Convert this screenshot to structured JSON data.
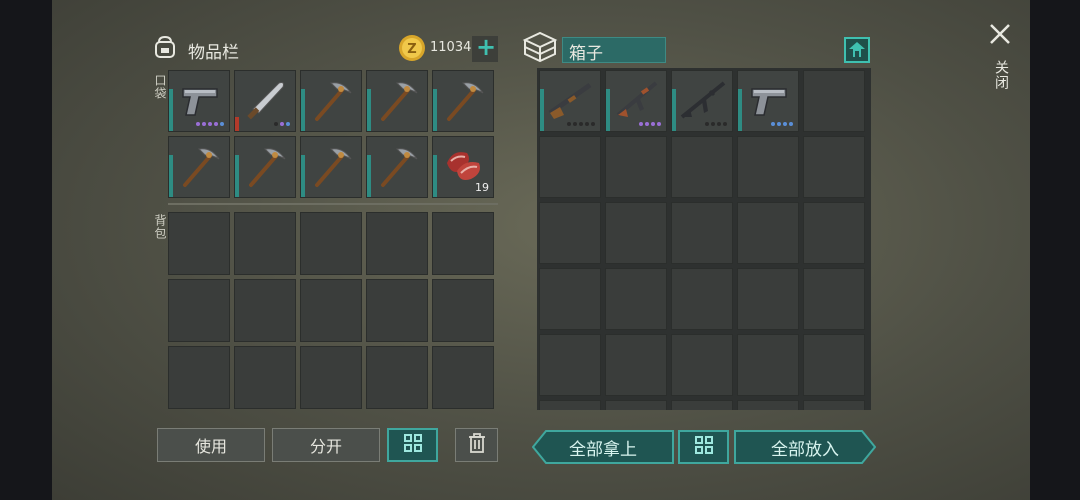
{
  "inventory": {
    "title": "物品栏",
    "pocket_label": "口袋",
    "backpack_label": "背包",
    "pocket_items": [
      {
        "icon": "pistol-icon",
        "dots": [
          "p",
          "p",
          "p",
          "p",
          "b"
        ]
      },
      {
        "icon": "machete-icon",
        "dots": [
          "",
          "p",
          "b"
        ],
        "bar": "red"
      },
      {
        "icon": "pickaxe-icon"
      },
      {
        "icon": "pickaxe-icon"
      },
      {
        "icon": "pickaxe-icon"
      },
      {
        "icon": "pickaxe-icon"
      },
      {
        "icon": "pickaxe-icon"
      },
      {
        "icon": "pickaxe-icon"
      },
      {
        "icon": "pickaxe-icon"
      },
      {
        "icon": "raw-meat-icon",
        "qty": "19"
      }
    ]
  },
  "currency": {
    "icon": "coin-icon",
    "amount": "11034",
    "add_icon": "plus-icon"
  },
  "box": {
    "title": "箱子",
    "items": [
      {
        "icon": "shotgun-icon",
        "dots": [
          "",
          "",
          "",
          "",
          ""
        ]
      },
      {
        "icon": "assault-rifle-icon",
        "dots": [
          "p",
          "p",
          "p",
          "p"
        ]
      },
      {
        "icon": "rifle-icon",
        "dots": [
          "",
          "",
          "",
          ""
        ]
      },
      {
        "icon": "pistol-icon",
        "dots": [
          "b",
          "b",
          "b",
          "b"
        ]
      }
    ]
  },
  "buttons": {
    "use": "使用",
    "split": "分开",
    "take_all": "全部拿上",
    "put_all": "全部放入"
  },
  "close": {
    "label": "关闭"
  },
  "colors": {
    "accent": "#2e8c83",
    "rare": "#9a6fd6",
    "uncommon": "#5a8fd8"
  }
}
